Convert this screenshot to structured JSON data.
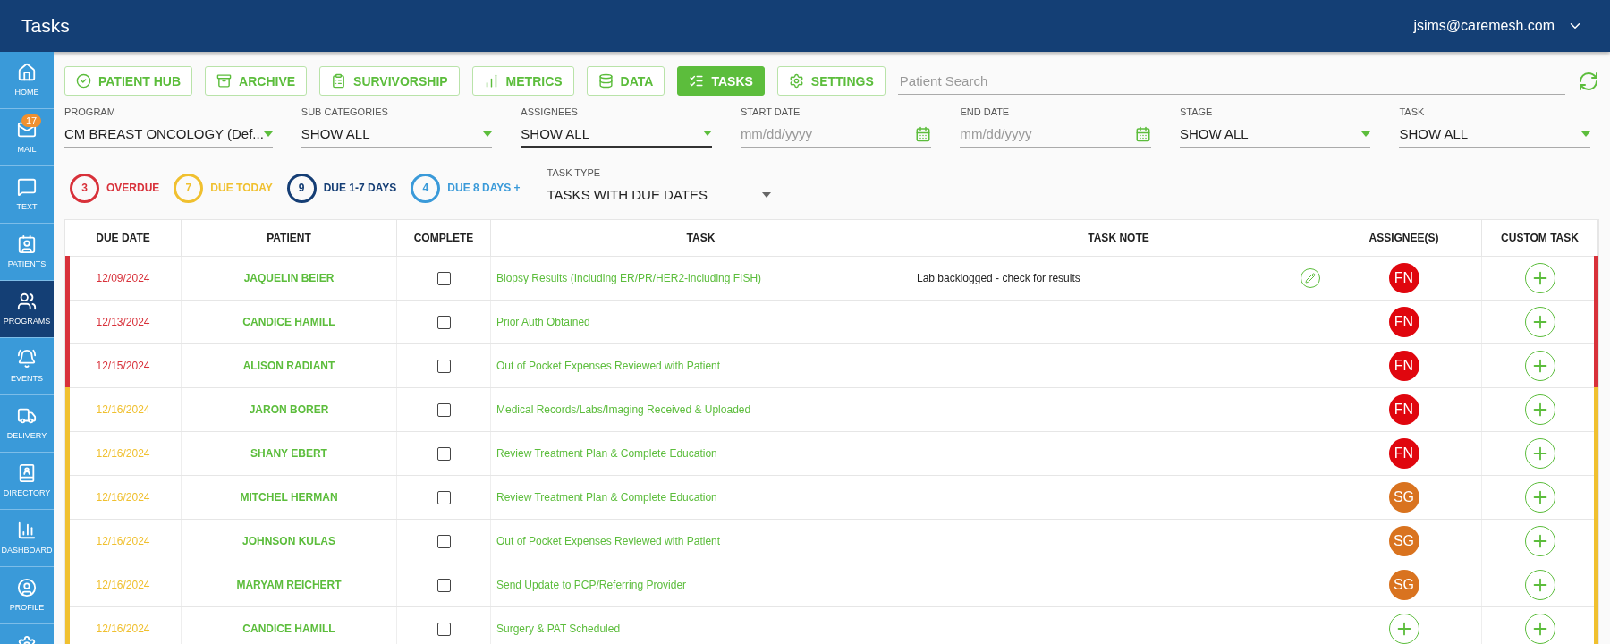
{
  "header": {
    "title": "Tasks",
    "user": "jsims@caremesh.com"
  },
  "sidebar": [
    {
      "label": "HOME",
      "selected": false
    },
    {
      "label": "MAIL",
      "selected": false,
      "badge": "17"
    },
    {
      "label": "TEXT",
      "selected": false
    },
    {
      "label": "PATIENTS",
      "selected": false
    },
    {
      "label": "PROGRAMS",
      "selected": true
    },
    {
      "label": "EVENTS",
      "selected": false
    },
    {
      "label": "DELIVERY",
      "selected": false
    },
    {
      "label": "DIRECTORY",
      "selected": false
    },
    {
      "label": "DASHBOARD",
      "selected": false
    },
    {
      "label": "PROFILE",
      "selected": false
    },
    {
      "selected": false
    }
  ],
  "toolbar": [
    {
      "label": "PATIENT HUB",
      "selected": false
    },
    {
      "label": "ARCHIVE",
      "selected": false
    },
    {
      "label": "SURVIVORSHIP",
      "selected": false
    },
    {
      "label": "METRICS",
      "selected": false
    },
    {
      "label": "DATA",
      "selected": false
    },
    {
      "label": "TASKS",
      "selected": true
    },
    {
      "label": "SETTINGS",
      "selected": false
    }
  ],
  "search": {
    "placeholder": "Patient Search"
  },
  "filters": [
    {
      "kind": "select",
      "label": "PROGRAM",
      "value": "CM BREAST ONCOLOGY (Def...",
      "focused": false
    },
    {
      "kind": "select",
      "label": "SUB CATEGORIES",
      "value": "SHOW ALL",
      "focused": false
    },
    {
      "kind": "select",
      "label": "ASSIGNEES",
      "value": "SHOW ALL",
      "focused": true
    },
    {
      "kind": "date",
      "label": "START DATE",
      "placeholder": "mm/dd/yyyy",
      "focused": false
    },
    {
      "kind": "date",
      "label": "END DATE",
      "placeholder": "mm/dd/yyyy",
      "focused": false
    },
    {
      "kind": "select",
      "label": "STAGE",
      "value": "SHOW ALL",
      "focused": false
    },
    {
      "kind": "select",
      "label": "TASK",
      "value": "SHOW ALL",
      "focused": false
    }
  ],
  "counters": [
    {
      "count": "3",
      "label": "OVERDUE",
      "color": "#d8313a"
    },
    {
      "count": "7",
      "label": "DUE TODAY",
      "color": "#f0c02f"
    },
    {
      "count": "9",
      "label": "DUE 1-7 DAYS",
      "color": "#153e75"
    },
    {
      "count": "4",
      "label": "DUE 8 DAYS +",
      "color": "#3a9ad9"
    }
  ],
  "task_type": {
    "label": "TASK TYPE",
    "value": "TASKS WITH DUE DATES"
  },
  "table": {
    "columns": [
      "DUE DATE",
      "PATIENT",
      "COMPLETE",
      "TASK",
      "TASK NOTE",
      "ASSIGNEE(S)",
      "CUSTOM TASK"
    ],
    "rows": [
      {
        "due": "12/09/2024",
        "color": "#d8313a",
        "patient": "JAQUELIN BEIER",
        "checked": false,
        "task": "Biopsy Results (Including ER/PR/HER2-including FISH)",
        "note": "Lab backlogged - check for results",
        "assignee": {
          "initials": "FN",
          "color": "#e0060e"
        }
      },
      {
        "due": "12/13/2024",
        "color": "#d8313a",
        "patient": "CANDICE HAMILL",
        "checked": false,
        "task": "Prior Auth Obtained",
        "assignee": {
          "initials": "FN",
          "color": "#e0060e"
        }
      },
      {
        "due": "12/15/2024",
        "color": "#d8313a",
        "patient": "ALISON RADIANT",
        "checked": false,
        "task": "Out of Pocket Expenses Reviewed with Patient",
        "assignee": {
          "initials": "FN",
          "color": "#e0060e"
        }
      },
      {
        "due": "12/16/2024",
        "color": "#f0c02f",
        "patient": "JARON BORER",
        "checked": false,
        "task": "Medical Records/Labs/Imaging Received & Uploaded",
        "assignee": {
          "initials": "FN",
          "color": "#e0060e"
        }
      },
      {
        "due": "12/16/2024",
        "color": "#f0c02f",
        "patient": "SHANY EBERT",
        "checked": false,
        "task": "Review Treatment Plan & Complete Education",
        "assignee": {
          "initials": "FN",
          "color": "#e0060e"
        }
      },
      {
        "due": "12/16/2024",
        "color": "#f0c02f",
        "patient": "MITCHEL HERMAN",
        "checked": false,
        "task": "Review Treatment Plan & Complete Education",
        "assignee": {
          "initials": "SG",
          "color": "#d9731f"
        }
      },
      {
        "due": "12/16/2024",
        "color": "#f0c02f",
        "patient": "JOHNSON KULAS",
        "checked": false,
        "task": "Out of Pocket Expenses Reviewed with Patient",
        "assignee": {
          "initials": "SG",
          "color": "#d9731f"
        }
      },
      {
        "due": "12/16/2024",
        "color": "#f0c02f",
        "patient": "MARYAM REICHERT",
        "checked": false,
        "task": "Send Update to PCP/Referring Provider",
        "assignee": {
          "initials": "SG",
          "color": "#d9731f"
        }
      },
      {
        "due": "12/16/2024",
        "color": "#f0c02f",
        "patient": "CANDICE HAMILL",
        "checked": false,
        "task": "Surgery & PAT Scheduled"
      }
    ]
  }
}
